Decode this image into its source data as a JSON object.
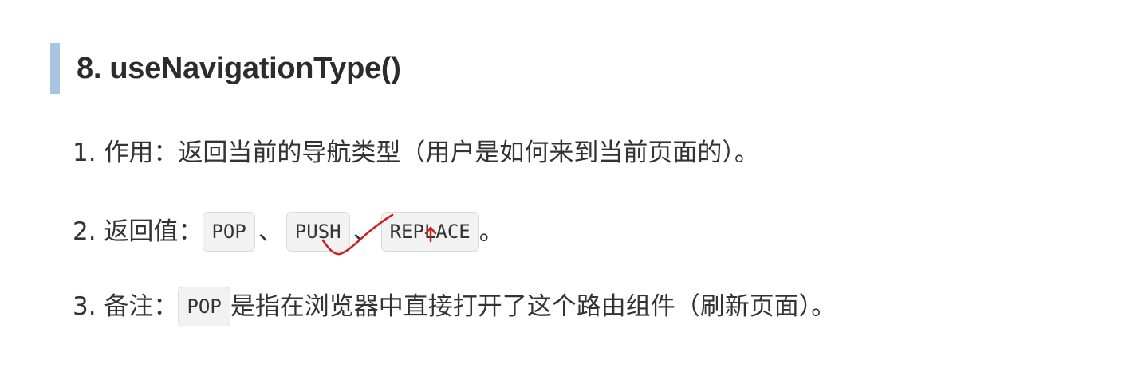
{
  "heading": {
    "title": "8. useNavigationType()"
  },
  "items": [
    {
      "text": "1. 作用：返回当前的导航类型（用户是如何来到当前页面的）。"
    },
    {
      "prefix": "2. 返回值：",
      "values": [
        "POP",
        "PUSH",
        "REPLACE"
      ],
      "separator": "、",
      "suffix": "。"
    },
    {
      "prefix": "3. 备注：",
      "code": "POP",
      "rest": "是指在浏览器中直接打开了这个路由组件（刷新页面）。"
    }
  ],
  "colors": {
    "heading_bar": "#a8c4de",
    "annotation": "#cc1f1f"
  }
}
